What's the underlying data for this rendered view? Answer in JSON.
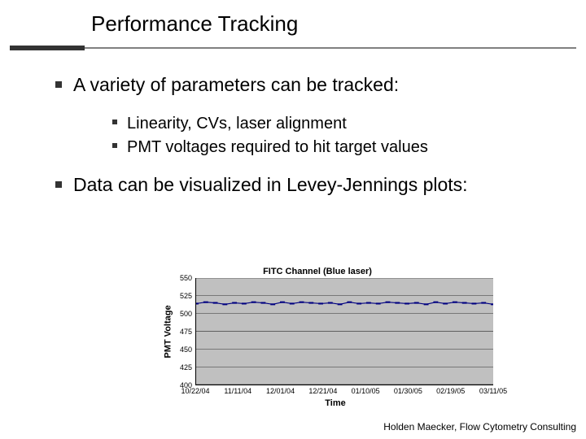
{
  "title": "Performance Tracking",
  "bullets": {
    "b1": "A variety of parameters can be tracked:",
    "b1a": "Linearity, CVs, laser alignment",
    "b1b": "PMT voltages required to hit target values",
    "b2": "Data can be visualized in Levey-Jennings plots:"
  },
  "footer": "Holden Maecker, Flow Cytometry Consulting",
  "chart_data": {
    "type": "line",
    "title": "FITC Channel (Blue laser)",
    "xlabel": "Time",
    "ylabel": "PMT Voltage",
    "ylim": [
      400,
      550
    ],
    "yticks": [
      400,
      425,
      450,
      475,
      500,
      525,
      550
    ],
    "categories": [
      "10/22/04",
      "11/11/04",
      "12/01/04",
      "12/21/04",
      "01/10/05",
      "01/30/05",
      "02/19/05",
      "03/11/05"
    ],
    "series": [
      {
        "name": "PMT Voltage",
        "color": "#000080",
        "values": [
          514,
          516,
          515,
          513,
          515,
          514,
          516,
          515,
          513,
          516,
          514,
          516,
          515,
          514,
          515,
          513,
          516,
          514,
          515,
          514,
          516,
          515,
          514,
          515,
          513,
          516,
          514,
          516,
          515,
          514,
          515,
          513
        ]
      }
    ],
    "reference_lines": [
      {
        "y": 520,
        "color": "#c0c0c0"
      },
      {
        "y": 510,
        "color": "#c0c0c0"
      },
      {
        "y": 435,
        "color": "#c0c0c0"
      }
    ]
  }
}
